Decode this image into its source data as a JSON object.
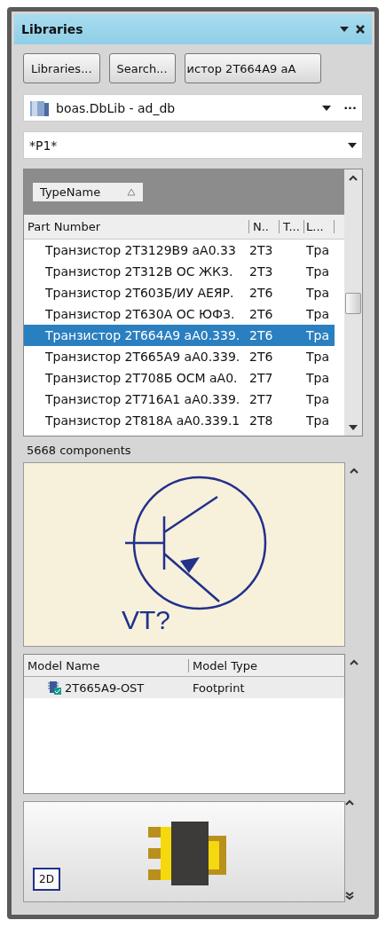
{
  "panel": {
    "title": "Libraries"
  },
  "buttons": [
    "Libraries...",
    "Search...",
    "истор 2Т664А9 аА"
  ],
  "library_dropdown": {
    "value": "boas.DbLib - ad_db",
    "more": "···"
  },
  "filter_dropdown": {
    "value": "*P1*"
  },
  "group_by": {
    "label": "TypeName"
  },
  "table": {
    "columns": [
      "Part Number",
      "N..",
      "T...",
      "L..."
    ],
    "rows": [
      {
        "cells": [
          "Транзистор 2Т3129В9 аА0.33",
          "2Т3",
          "",
          "Тра"
        ],
        "selected": false
      },
      {
        "cells": [
          "Транзистор 2Т312В ОС ЖКЗ.",
          "2Т3",
          "",
          "Тра"
        ],
        "selected": false
      },
      {
        "cells": [
          "Транзистор 2Т603Б/ИУ АЕЯР.",
          "2Т6",
          "",
          "Тра"
        ],
        "selected": false
      },
      {
        "cells": [
          "Транзистор 2Т630А ОС ЮФЗ.",
          "2Т6",
          "",
          "Тра"
        ],
        "selected": false
      },
      {
        "cells": [
          "Транзистор 2Т664А9 аА0.339.",
          "2Т6",
          "",
          "Тра"
        ],
        "selected": true
      },
      {
        "cells": [
          "Транзистор 2Т665А9 аА0.339.",
          "2Т6",
          "",
          "Тра"
        ],
        "selected": false
      },
      {
        "cells": [
          "Транзистор 2Т708Б ОСМ аА0.",
          "2Т7",
          "",
          "Тра"
        ],
        "selected": false
      },
      {
        "cells": [
          "Транзистор 2Т716А1 аА0.339.",
          "2Т7",
          "",
          "Тра"
        ],
        "selected": false
      },
      {
        "cells": [
          "Транзистор 2Т818А аА0.339.1",
          "2Т8",
          "",
          "Тра"
        ],
        "selected": false
      }
    ]
  },
  "status": "5668 components",
  "symbol_preview": {
    "designator": "VT?"
  },
  "models": {
    "columns": [
      "Model Name",
      "Model Type"
    ],
    "rows": [
      {
        "name": "2Т665А9-OST",
        "type": "Footprint"
      }
    ]
  },
  "footprint_preview": {
    "view_button": "2D"
  }
}
